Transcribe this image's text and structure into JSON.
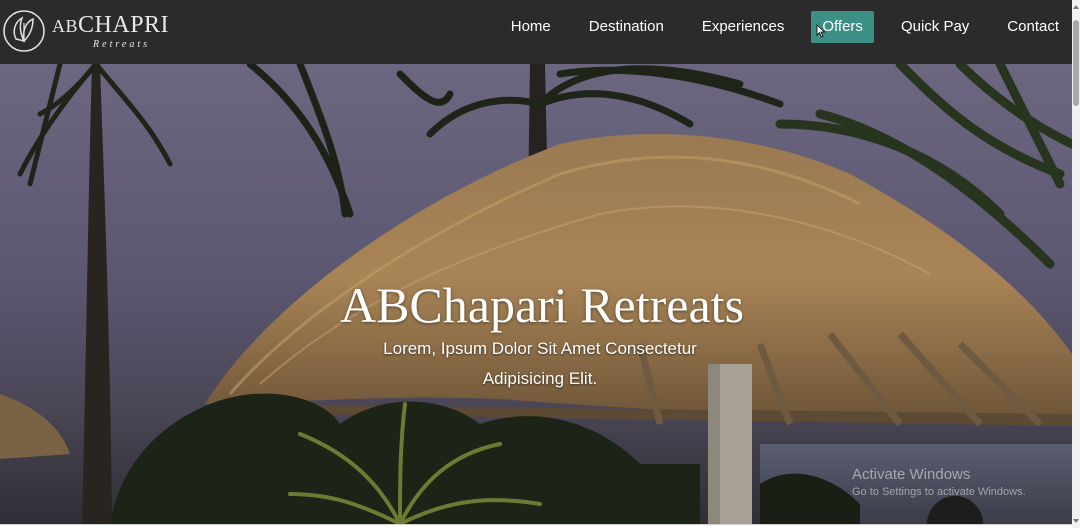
{
  "brand": {
    "name_part1": "AB",
    "name_part2": "CHAPRI",
    "tagline": "Retreats"
  },
  "nav": {
    "items": [
      {
        "label": "Home",
        "active": false
      },
      {
        "label": "Destination",
        "active": false
      },
      {
        "label": "Experiences",
        "active": false
      },
      {
        "label": "Offers",
        "active": true
      },
      {
        "label": "Quick Pay",
        "active": false
      },
      {
        "label": "Contact",
        "active": false
      }
    ],
    "active_color": "#3b8f85",
    "bar_color": "#2b2b2b"
  },
  "hero": {
    "title": "ABChapari Retreats",
    "subtitle_line1": "Lorem, Ipsum Dolor Sit Amet Consectetur",
    "subtitle_line2": "Adipisicing Elit."
  },
  "os_watermark": {
    "title": "Activate Windows",
    "subtitle": "Go to Settings to activate Windows."
  }
}
